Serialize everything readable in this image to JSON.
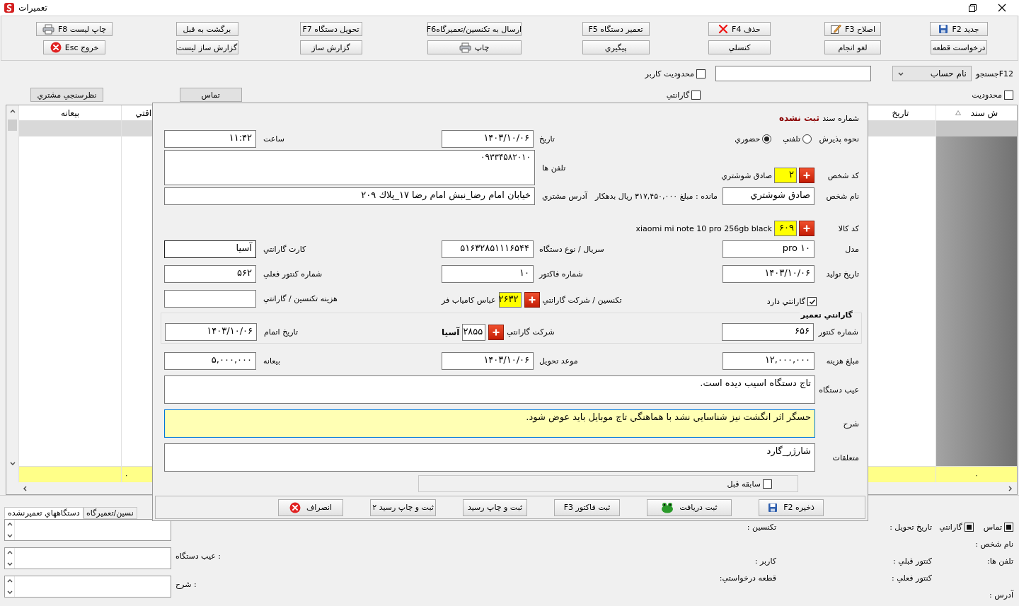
{
  "window": {
    "title": "تعميرات"
  },
  "toolbar": {
    "rows": [
      [
        {
          "label": "جديد F2",
          "kind": "save"
        },
        {
          "label": "اصلاح F3",
          "kind": "edit"
        },
        {
          "label": "حذف F4",
          "kind": "delete"
        },
        {
          "label": "تعمير دستگاه F5",
          "kind": "plain"
        },
        {
          "label": "ارسال به تكنسين/تعميرگاهF6",
          "kind": "plain"
        },
        {
          "label": "تحويل دستگاه F7",
          "kind": "plain"
        },
        {
          "label": "برگشت به قبل",
          "kind": "plain"
        },
        {
          "label": "چاپ ليست F8",
          "kind": "print"
        }
      ],
      [
        {
          "label": "درخواست قطعه",
          "kind": "plain"
        },
        {
          "label": "لغو انجام",
          "kind": "plain"
        },
        {
          "label": "كنسلي",
          "kind": "plain"
        },
        {
          "label": "پيگيري",
          "kind": "plain"
        },
        {
          "label": "چاپ",
          "kind": "print"
        },
        {
          "label": "گزارش ساز",
          "kind": "plain"
        },
        {
          "label": "گزارش ساز ليست",
          "kind": "plain"
        },
        {
          "label": "خروج Esc",
          "kind": "exit"
        }
      ]
    ]
  },
  "filter": {
    "search_label": "F12جستجو",
    "search_by": "نام حساب",
    "user_limit": {
      "label": "محدوديت كاربر",
      "checked": false
    },
    "limit": {
      "label": "محدوديت",
      "checked": false
    },
    "warranty": {
      "label": "گارانتي",
      "checked": false
    },
    "contact_button": "تماس",
    "survey_button": "نظرسنجي مشتري"
  },
  "table": {
    "columns": [
      {
        "label": "ش سند",
        "sorted": true,
        "total": "۰"
      },
      {
        "label": "تاريخ",
        "sorted": false
      },
      {
        "label": "اقتي",
        "sorted": false,
        "total": "۰"
      },
      {
        "label": "بيعانه",
        "sorted": false
      }
    ],
    "rows": [
      {
        "selected": true
      }
    ]
  },
  "dialog": {
    "doc_label": "شماره سند",
    "doc_status": "ثبت نشده",
    "intake": {
      "label": "نحوه پذيرش",
      "options": [
        {
          "label": "تلفني",
          "selected": false
        },
        {
          "label": "حضوري",
          "selected": true
        }
      ]
    },
    "date": {
      "label": "تاريخ",
      "value": "۱۴۰۳/۱۰/۰۶"
    },
    "time": {
      "label": "ساعت",
      "value": "۱۱:۴۲"
    },
    "person_code": {
      "label": "كد شخص",
      "value": "۲",
      "name": "صادق شوشتري"
    },
    "phones": {
      "label": "تلفن ها",
      "value": "۰۹۳۳۴۵۸۲۰۱۰"
    },
    "person_name": {
      "label": "نام شخص",
      "value": "صادق شوشتري"
    },
    "balance_note": "مانده : مبلغ ۳۱۷,۴۵۰,۰۰۰ ريال بدهكار",
    "address": {
      "label": "آدرس مشتري",
      "value": "خيابان امام رضا_نبش امام رضا ۱۷_پلاك ۲۰۹"
    },
    "item_code": {
      "label": "كد كالا",
      "value": "۶۰۹",
      "name": "xiaomi mi note 10 pro 256gb black"
    },
    "model": {
      "label": "مدل",
      "value": "۱۰ pro"
    },
    "serial": {
      "label": "سريال / نوع دستگاه",
      "value": "۵۱۶۳۲۸۵۱۱۱۶۵۴۴"
    },
    "warranty_card": {
      "label": "كارت گارانتي",
      "value": "آسيا"
    },
    "production_date": {
      "label": "تاريخ توليد",
      "value": "۱۴۰۳/۱۰/۰۶"
    },
    "invoice_no": {
      "label": "شماره فاكتور",
      "value": "۱۰"
    },
    "current_meter": {
      "label": "شماره كنتور فعلي",
      "value": "۵۶۲"
    },
    "has_warranty": {
      "label": "گارانتي دارد",
      "checked": true
    },
    "technician": {
      "label": "تكنسين / شركت گارانتي",
      "value": "۲۶۳۲",
      "name": "عباس كامياب فر"
    },
    "technician_cost": {
      "label": "هزينه تكنسين / گارانتي"
    },
    "warranty_repair": {
      "title": "گارانتي تعمير",
      "meter": {
        "label": "شماره كنتور",
        "value": "۶۵۶"
      },
      "company": {
        "label": "شركت گارانتي",
        "value": "۲۸۵۵",
        "name": "آسيا"
      },
      "end_date": {
        "label": "تاريخ اتمام",
        "value": "۱۴۰۳/۱۰/۰۶"
      }
    },
    "cost": {
      "label": "مبلغ هزينه",
      "value": "۱۲,۰۰۰,۰۰۰"
    },
    "delivery_date": {
      "label": "موعد تحويل",
      "value": "۱۴۰۳/۱۰/۰۶"
    },
    "deposit": {
      "label": "بيعانه",
      "value": "۵,۰۰۰,۰۰۰"
    },
    "defect": {
      "label": "عيب دستگاه",
      "value": "تاج دستگاه اسيب ديده است."
    },
    "description": {
      "label": "شرح",
      "value": "حسگر اثر انگشت نيز شناسايي نشد با هماهنگي تاج موبايل بايد عوض شود."
    },
    "accessories": {
      "label": "متعلقات",
      "value": "شارژر_گارد"
    },
    "history": {
      "label": "سابقه قبل",
      "checked": false
    },
    "buttons": [
      {
        "label": "ذخيره F2",
        "kind": "save"
      },
      {
        "label": "ثبت دريافت",
        "kind": "receive"
      },
      {
        "label": "ثبت فاكتور F3",
        "kind": "plain"
      },
      {
        "label": "ثبت و چاپ رسيد",
        "kind": "plain"
      },
      {
        "label": "ثبت و چاپ رسيد ۲",
        "kind": "plain"
      },
      {
        "label": "انصراف",
        "kind": "exit"
      }
    ]
  },
  "bottom_panel": {
    "tabs": [
      {
        "label": "نسين/تعميرگاه",
        "selected": false
      },
      {
        "label": "دستگاههاي تعميرنشده",
        "selected": true
      }
    ],
    "note_labels": [
      "عيب دستگاه :",
      "شرح :"
    ],
    "contact": {
      "label": "تماس",
      "checked": true
    },
    "warranty": {
      "label": "گارانتي",
      "checked": true
    },
    "info_columns": [
      [
        "نام شخص :",
        "تلفن ها:",
        "آدرس :"
      ],
      [
        "تاريخ تحويل :",
        "كنتور قبلي :",
        "كنتور فعلي :"
      ],
      [
        "تكنسين :",
        "كاربر :",
        "قطعه درخواستي:"
      ]
    ]
  }
}
